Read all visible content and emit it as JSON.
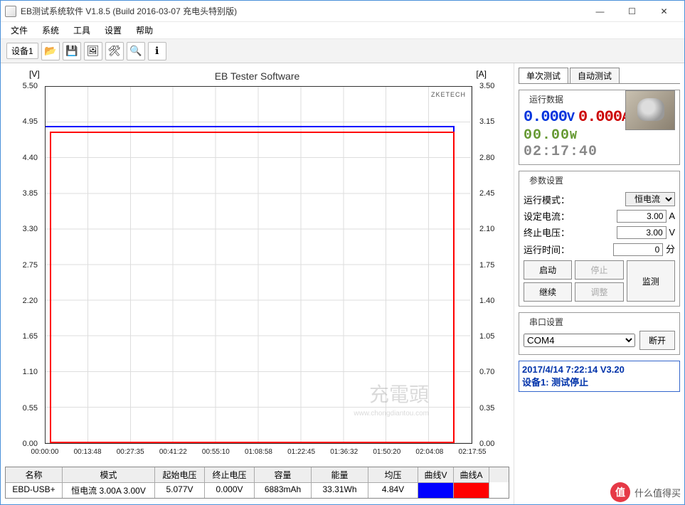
{
  "window": {
    "title": "EB测试系统软件 V1.8.5 (Build 2016-03-07 充电头特别版)"
  },
  "menu": {
    "file": "文件",
    "system": "系统",
    "tools": "工具",
    "settings": "设置",
    "help": "帮助"
  },
  "toolbar": {
    "device": "设备1"
  },
  "chart": {
    "title": "EB Tester Software",
    "ylabel_left": "[V]",
    "ylabel_right": "[A]",
    "brand": "ZKETECH",
    "watermark": "充電頭",
    "watermark_sub": "www.chongdiantou.com"
  },
  "chart_data": {
    "type": "line",
    "x_axis": {
      "type": "time",
      "range": [
        "00:00:00",
        "02:17:55"
      ],
      "ticks": [
        "00:00:00",
        "00:13:48",
        "00:27:35",
        "00:41:22",
        "00:55:10",
        "01:08:58",
        "01:22:45",
        "01:36:32",
        "01:50:20",
        "02:04:08",
        "02:17:55"
      ]
    },
    "y_axes": [
      {
        "side": "left",
        "label": "[V]",
        "range": [
          0.0,
          5.5
        ],
        "ticks": [
          0.0,
          0.55,
          1.1,
          1.65,
          2.2,
          2.75,
          3.3,
          3.85,
          4.4,
          4.95,
          5.5
        ],
        "color": "#0000ff"
      },
      {
        "side": "right",
        "label": "[A]",
        "range": [
          0.0,
          3.5
        ],
        "ticks": [
          0.0,
          0.35,
          0.7,
          1.05,
          1.4,
          1.75,
          2.1,
          2.45,
          2.8,
          3.15,
          3.5
        ],
        "color": "#ff0000"
      }
    ],
    "series": [
      {
        "name": "曲线V",
        "y_axis": "left",
        "color": "#0000ff",
        "approx_values": [
          {
            "t": "00:00:00",
            "v": 4.95
          },
          {
            "t": "00:00:10",
            "v": 4.85
          },
          {
            "t": "02:13:00",
            "v": 4.84
          },
          {
            "t": "02:13:10",
            "v": 0.0
          },
          {
            "t": "02:17:55",
            "v": 0.0
          }
        ]
      },
      {
        "name": "曲线A",
        "y_axis": "right",
        "color": "#ff0000",
        "approx_values": [
          {
            "t": "00:00:00",
            "v": 0.0
          },
          {
            "t": "00:00:10",
            "v": 3.0
          },
          {
            "t": "02:13:00",
            "v": 3.0
          },
          {
            "t": "02:13:10",
            "v": 0.0
          },
          {
            "t": "02:17:55",
            "v": 0.0
          }
        ]
      }
    ]
  },
  "table": {
    "headers": [
      "名称",
      "模式",
      "起始电压",
      "终止电压",
      "容量",
      "能量",
      "均压",
      "曲线V",
      "曲线A"
    ],
    "row": {
      "name": "EBD-USB+",
      "mode": "恒电流 3.00A 3.00V",
      "start_v": "5.077V",
      "end_v": "0.000V",
      "capacity": "6883mAh",
      "energy": "33.31Wh",
      "avg_v": "4.84V"
    }
  },
  "right": {
    "tabs": {
      "single": "单次测试",
      "auto": "自动测试"
    },
    "run_group": "运行数据",
    "volts": {
      "val": "0.000",
      "unit": "V"
    },
    "amps": {
      "val": "0.000",
      "unit": "A"
    },
    "watts": {
      "val": "00.00",
      "unit": "W"
    },
    "elapsed": "02:17:40",
    "param_group": "参数设置",
    "params": {
      "mode_label": "运行模式：",
      "mode_value": "恒电流",
      "current_label": "设定电流：",
      "current_value": "3.00",
      "current_unit": "A",
      "cutoff_label": "终止电压：",
      "cutoff_value": "3.00",
      "cutoff_unit": "V",
      "time_label": "运行时间：",
      "time_value": "0",
      "time_unit": "分"
    },
    "buttons": {
      "start": "启动",
      "stop": "停止",
      "continue": "继续",
      "adjust": "调整",
      "monitor": "监测"
    },
    "port_group": "串口设置",
    "port_value": "COM4",
    "port_btn": "断开",
    "status_time": "2017/4/14 7:22:14  V3.20",
    "status_text": "设备1: 测试停止"
  },
  "footer": {
    "badge": "值",
    "text": "什么值得买"
  }
}
